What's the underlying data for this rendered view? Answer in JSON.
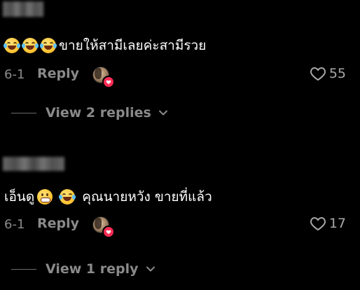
{
  "comments": [
    {
      "text_main": "ขายให้สามีเลยค่ะสามีรวย",
      "date": "6-1",
      "reply_label": "Reply",
      "like_count": "55",
      "view_replies_label": "View 2 replies"
    },
    {
      "text_prefix": "เอ็นดู",
      "text_main": "คุณนายหวัง ขายที่แล้ว",
      "date": "6-1",
      "reply_label": "Reply",
      "like_count": "17",
      "view_replies_label": "View 1 reply"
    }
  ],
  "icons": {
    "emoji_tears": "face-with-tears-of-joy",
    "emoji_grin": "grinning-face-with-teeth",
    "heart": "heart-outline-icon",
    "chevron": "chevron-down-icon",
    "creator_badge": "creator-liked-heart-badge"
  },
  "colors": {
    "background": "#000000",
    "text": "#ffffff",
    "muted": "#8a8a8a",
    "badge": "#fe2c55"
  }
}
